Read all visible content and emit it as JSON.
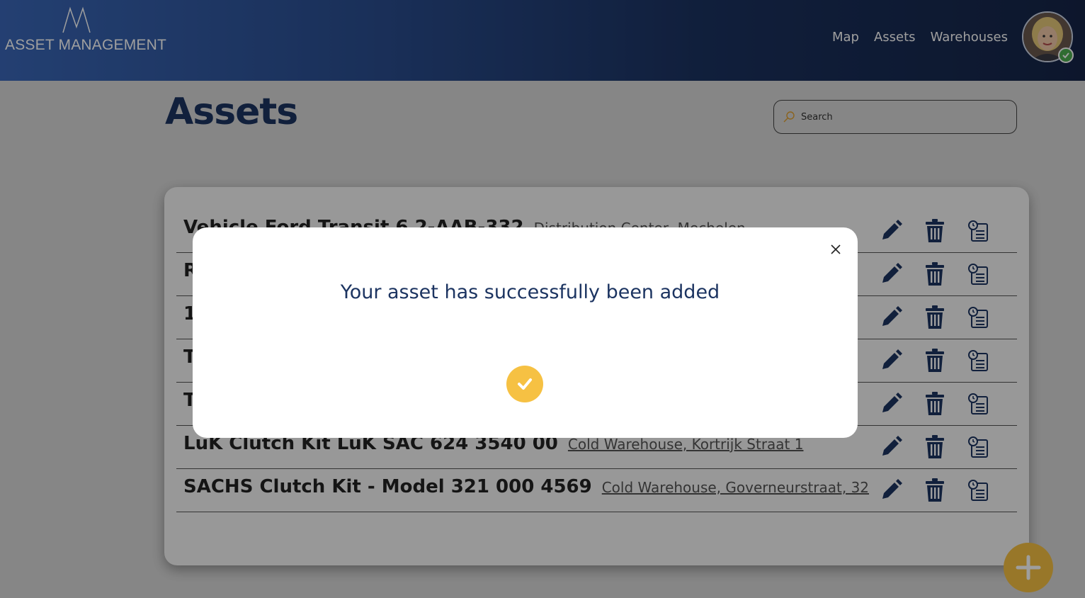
{
  "header": {
    "logo_text": "ASSET MANAGEMENT",
    "nav": [
      {
        "label": "Map"
      },
      {
        "label": "Assets"
      },
      {
        "label": "Warehouses"
      }
    ],
    "avatar_icon": "user-avatar",
    "status_icon": "online-check-icon"
  },
  "page": {
    "title": "Assets",
    "search": {
      "placeholder": "Search",
      "value": ""
    }
  },
  "assets": [
    {
      "name": "Vehicle Ford Transit 6 2-AAB-332",
      "location": "Distribution Center, Mechelen"
    },
    {
      "name": "R",
      "location": ""
    },
    {
      "name": "1",
      "location": ""
    },
    {
      "name": "T",
      "location": ""
    },
    {
      "name": "T",
      "location": ""
    },
    {
      "name": "LuK Clutch Kit LuK SAC 624 3540 00",
      "location": "Cold Warehouse, Kortrijk Straat 1"
    },
    {
      "name": "SACHS Clutch Kit - Model 321 000 4569",
      "location": "Cold Warehouse, Governeurstraat, 32"
    }
  ],
  "row_actions": [
    "edit-icon",
    "delete-icon",
    "history-icon"
  ],
  "fab_icon": "plus-icon",
  "modal": {
    "message": "Your asset has successfully been added",
    "close_icon": "close-icon",
    "status_icon": "check-icon"
  },
  "colors": {
    "primary": "#1c3461",
    "accent": "#f6c143",
    "success": "#4caf50"
  }
}
